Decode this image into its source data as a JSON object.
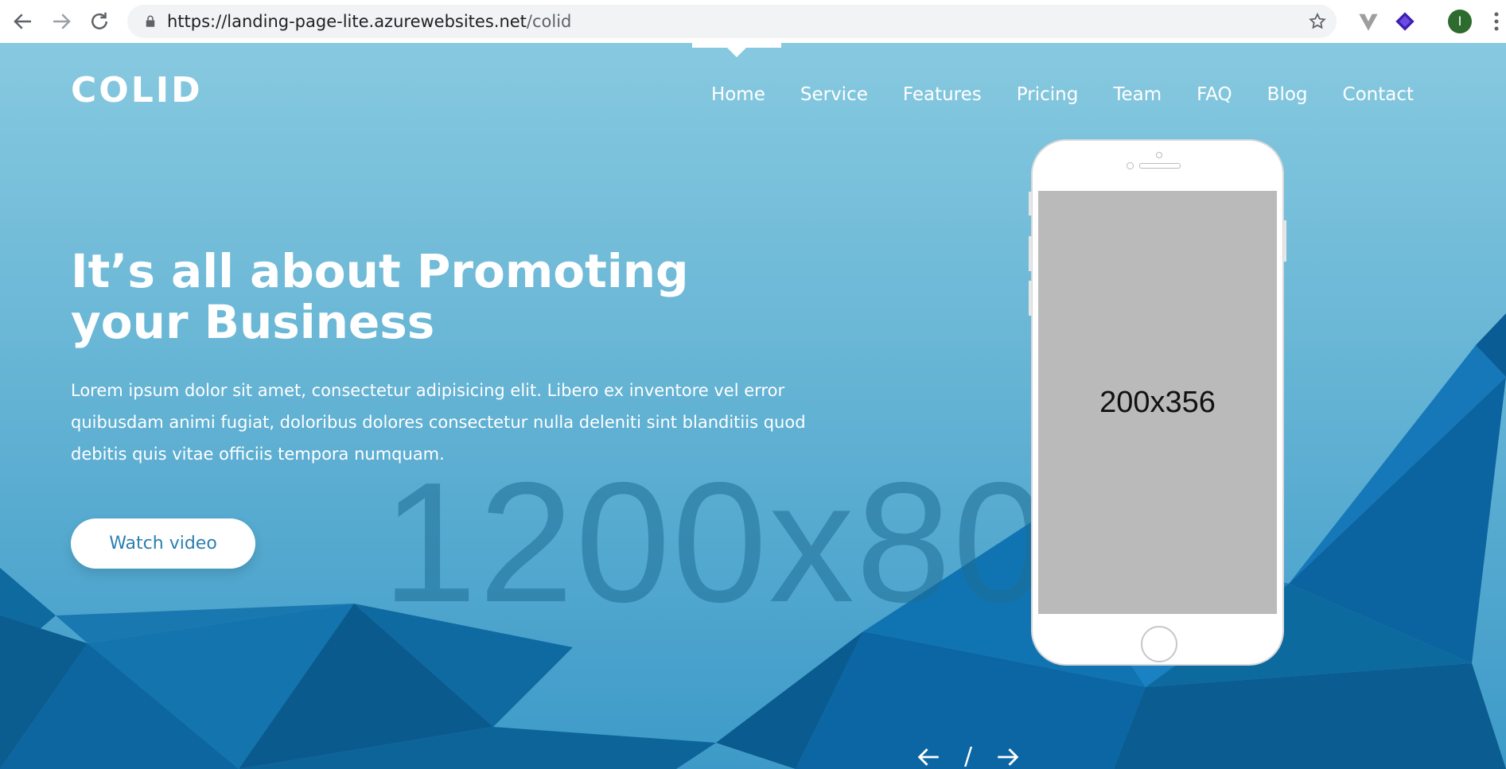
{
  "browser": {
    "url_base": "https://landing-page-lite.azurewebsites.net",
    "url_path": "/colid",
    "profile_initial": "I",
    "icons": [
      "back-arrow-icon",
      "forward-arrow-icon",
      "reload-icon",
      "lock-icon",
      "star-icon",
      "extension-v-icon",
      "extension-layers-icon",
      "kebab-menu-icon"
    ]
  },
  "site": {
    "logo": "COLID",
    "nav": [
      "Home",
      "Service",
      "Features",
      "Pricing",
      "Team",
      "FAQ",
      "Blog",
      "Contact"
    ],
    "active_nav": "Home"
  },
  "hero": {
    "headline": "It’s all about Promoting your Business",
    "description": "Lorem ipsum dolor sit amet, consectetur adipisicing elit. Libero ex inventore vel error quibusdam animi fugiat, doloribus dolores consectetur nulla deleniti sint blanditiis quod debitis quis vitae officiis tempora numquam.",
    "cta_label": "Watch video",
    "background_placeholder": "1200x80",
    "phone_placeholder": "200x356",
    "slider_separator": "/"
  },
  "colors": {
    "accent": "#2a7fb0",
    "hero_top": "#87c9e0",
    "hero_bottom": "#3d9ac8",
    "poly_dark": "#0a5e96"
  }
}
